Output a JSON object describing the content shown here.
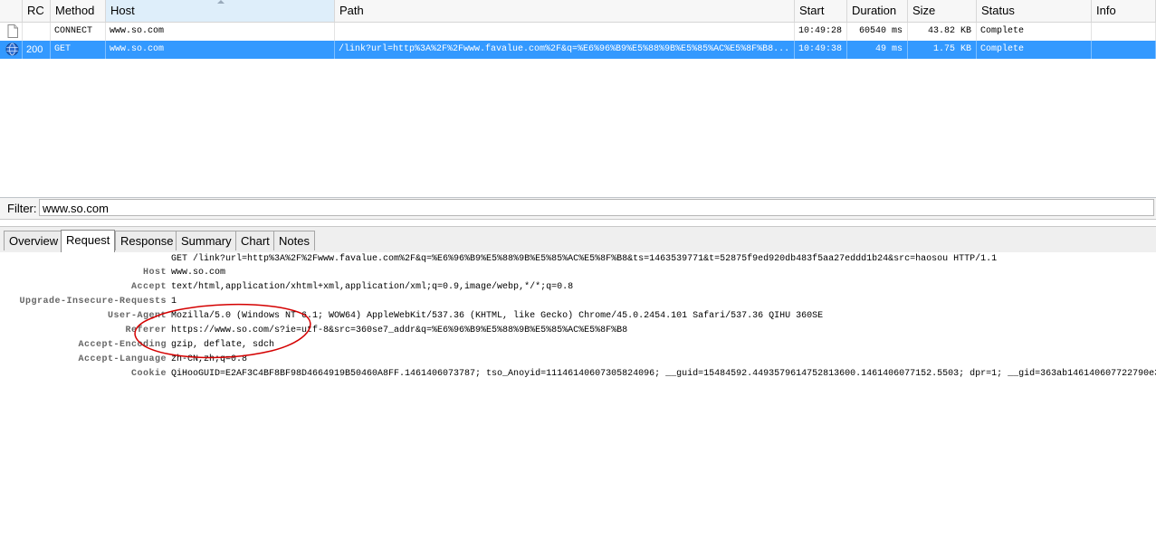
{
  "grid": {
    "columns": {
      "rc": "RC",
      "method": "Method",
      "host": "Host",
      "path": "Path",
      "start": "Start",
      "duration": "Duration",
      "size": "Size",
      "status": "Status",
      "info": "Info"
    },
    "rows": [
      {
        "icon": "document-icon",
        "rc": "",
        "method": "CONNECT",
        "host": "www.so.com",
        "path": "",
        "start": "10:49:28",
        "duration": "60540 ms",
        "size": "43.82 KB",
        "status": "Complete",
        "info": "",
        "selected": false
      },
      {
        "icon": "globe-icon",
        "rc": "200",
        "method": "GET",
        "host": "www.so.com",
        "path": "/link?url=http%3A%2F%2Fwww.favalue.com%2F&q=%E6%96%B9%E5%88%9B%E5%85%AC%E5%8F%B8...",
        "start": "10:49:38",
        "duration": "49 ms",
        "size": "1.75 KB",
        "status": "Complete",
        "info": "",
        "selected": true
      }
    ]
  },
  "filter": {
    "label": "Filter:",
    "value": "www.so.com"
  },
  "tabs": [
    "Overview",
    "Request",
    "Response",
    "Summary",
    "Chart",
    "Notes"
  ],
  "active_tab": "Request",
  "request": {
    "request_line": "GET /link?url=http%3A%2F%2Fwww.favalue.com%2F&q=%E6%96%B9%E5%88%9B%E5%85%AC%E5%8F%B8&ts=1463539771&t=52875f9ed920db483f5aa27eddd1b24&src=haosou HTTP/1.1",
    "headers": [
      {
        "name": "Host",
        "value": "www.so.com"
      },
      {
        "name": "Accept",
        "value": "text/html,application/xhtml+xml,application/xml;q=0.9,image/webp,*/*;q=0.8"
      },
      {
        "name": "Upgrade-Insecure-Requests",
        "value": "1"
      },
      {
        "name": "User-Agent",
        "value": "Mozilla/5.0 (Windows NT 6.1; WOW64) AppleWebKit/537.36 (KHTML, like Gecko) Chrome/45.0.2454.101 Safari/537.36 QIHU 360SE"
      },
      {
        "name": "Referer",
        "value": "https://www.so.com/s?ie=utf-8&src=360se7_addr&q=%E6%96%B9%E5%88%9B%E5%85%AC%E5%8F%B8"
      },
      {
        "name": "Accept-Encoding",
        "value": "gzip, deflate, sdch"
      },
      {
        "name": "Accept-Language",
        "value": "zh-CN,zh;q=0.8"
      },
      {
        "name": "Cookie",
        "value": "QiHooGUID=E2AF3C4BF8BF98D4664919B50460A8FF.1461406073787; tso_Anoyid=11146140607305824096; __guid=15484592.4493579614752813600.1461406077152.5503; dpr=1; __gid=363ab146140607722790e3"
      }
    ]
  },
  "colors": {
    "selection": "#3399ff",
    "annotation": "#d40000"
  }
}
